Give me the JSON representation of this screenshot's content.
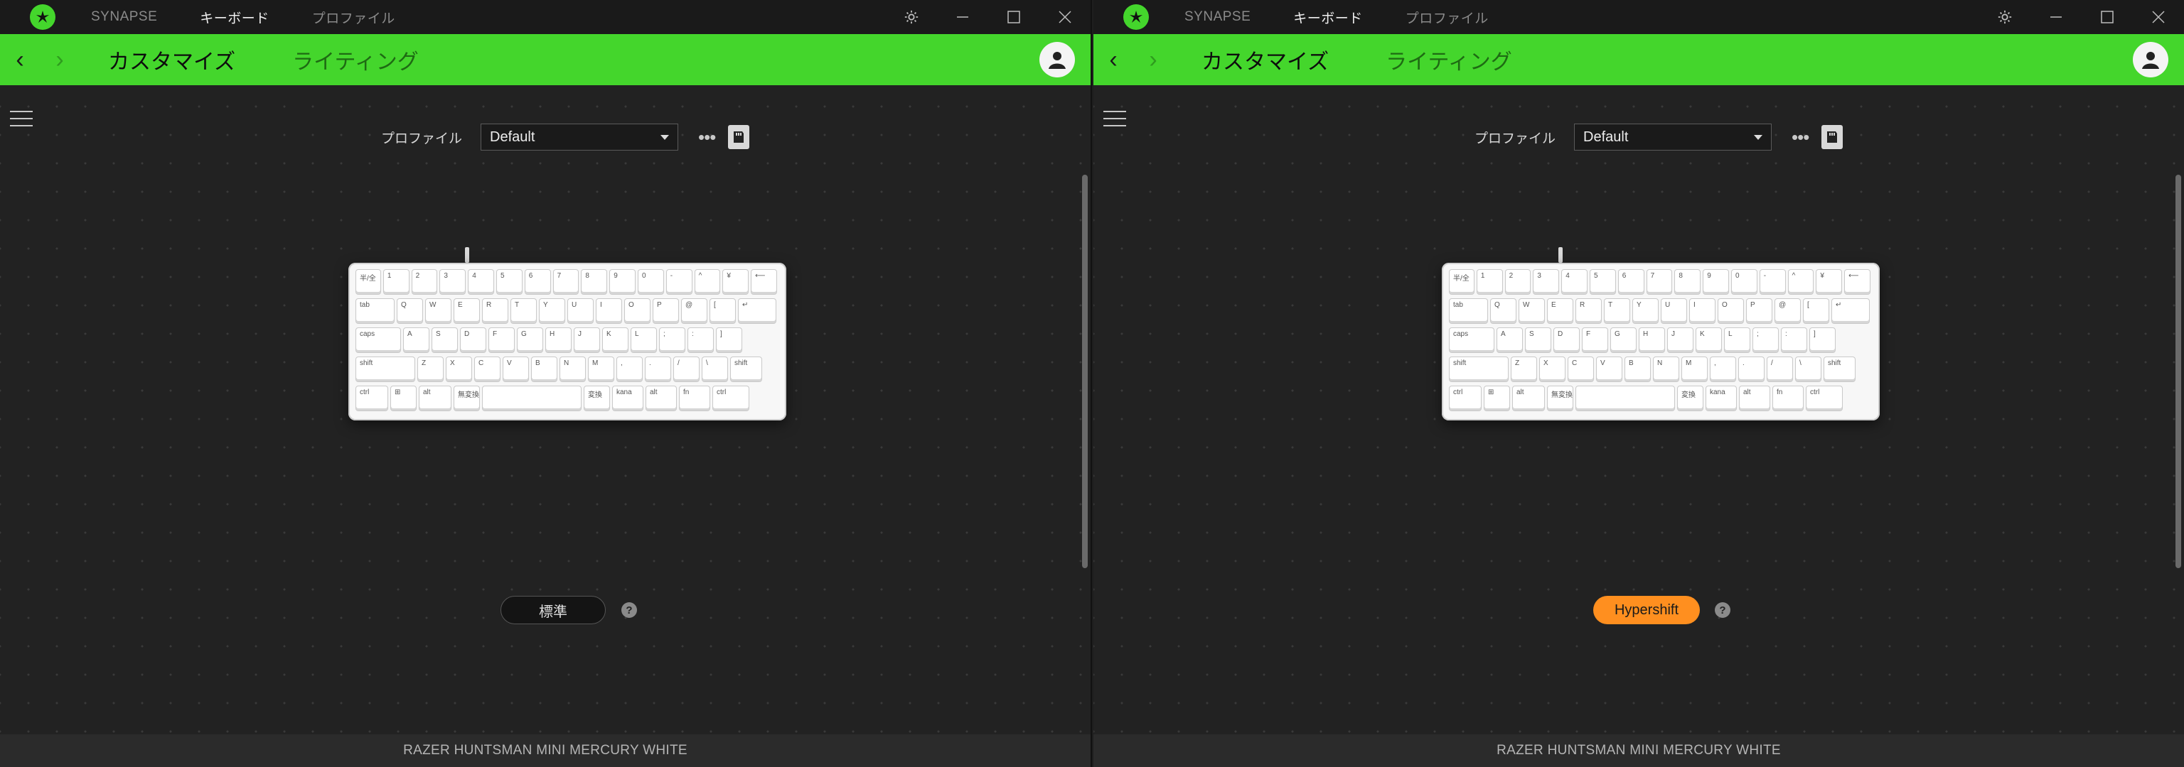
{
  "windows": [
    {
      "titlebar": {
        "nav": [
          "SYNAPSE",
          "キーボード",
          "プロファイル"
        ],
        "active_index": 1
      },
      "toolbar": {
        "tabs": [
          "カスタマイズ",
          "ライティング"
        ]
      },
      "profile": {
        "label": "プロファイル",
        "selected": "Default"
      },
      "mode": {
        "label": "標準",
        "style": "standard",
        "help": "?"
      },
      "footer": "RAZER HUNTSMAN MINI MERCURY WHITE"
    },
    {
      "titlebar": {
        "nav": [
          "SYNAPSE",
          "キーボード",
          "プロファイル"
        ],
        "active_index": 1
      },
      "toolbar": {
        "tabs": [
          "カスタマイズ",
          "ライティング"
        ]
      },
      "profile": {
        "label": "プロファイル",
        "selected": "Default"
      },
      "mode": {
        "label": "Hypershift",
        "style": "hypershift",
        "help": "?"
      },
      "footer": "RAZER HUNTSMAN MINI MERCURY WHITE"
    }
  ],
  "icons": {
    "logo": "razer-logo-icon",
    "settings": "gear-icon",
    "minimize": "minimize-icon",
    "maximize": "maximize-icon",
    "close": "close-icon",
    "back": "chevron-left-icon",
    "forward": "chevron-right-icon",
    "user": "user-icon",
    "menu": "hamburger-icon",
    "more": "more-icon",
    "onboard": "onboard-memory-icon"
  },
  "colors": {
    "accent": "#44d62c",
    "hypershift": "#ff8f1f"
  },
  "keyboard": {
    "rows": [
      [
        "半/全",
        "1",
        "2",
        "3",
        "4",
        "5",
        "6",
        "7",
        "8",
        "9",
        "0",
        "-",
        "^",
        "¥",
        "⟵"
      ],
      [
        "tab",
        "Q",
        "W",
        "E",
        "R",
        "T",
        "Y",
        "U",
        "I",
        "O",
        "P",
        "@",
        "[",
        "↵"
      ],
      [
        "caps",
        "A",
        "S",
        "D",
        "F",
        "G",
        "H",
        "J",
        "K",
        "L",
        ";",
        ":",
        "]"
      ],
      [
        "shift",
        "Z",
        "X",
        "C",
        "V",
        "B",
        "N",
        "M",
        ",",
        ".",
        "/",
        "\\",
        "shift"
      ],
      [
        "ctrl",
        "⊞",
        "alt",
        "無変換",
        "",
        "変換",
        "kana",
        "alt",
        "fn",
        "ctrl"
      ]
    ]
  }
}
